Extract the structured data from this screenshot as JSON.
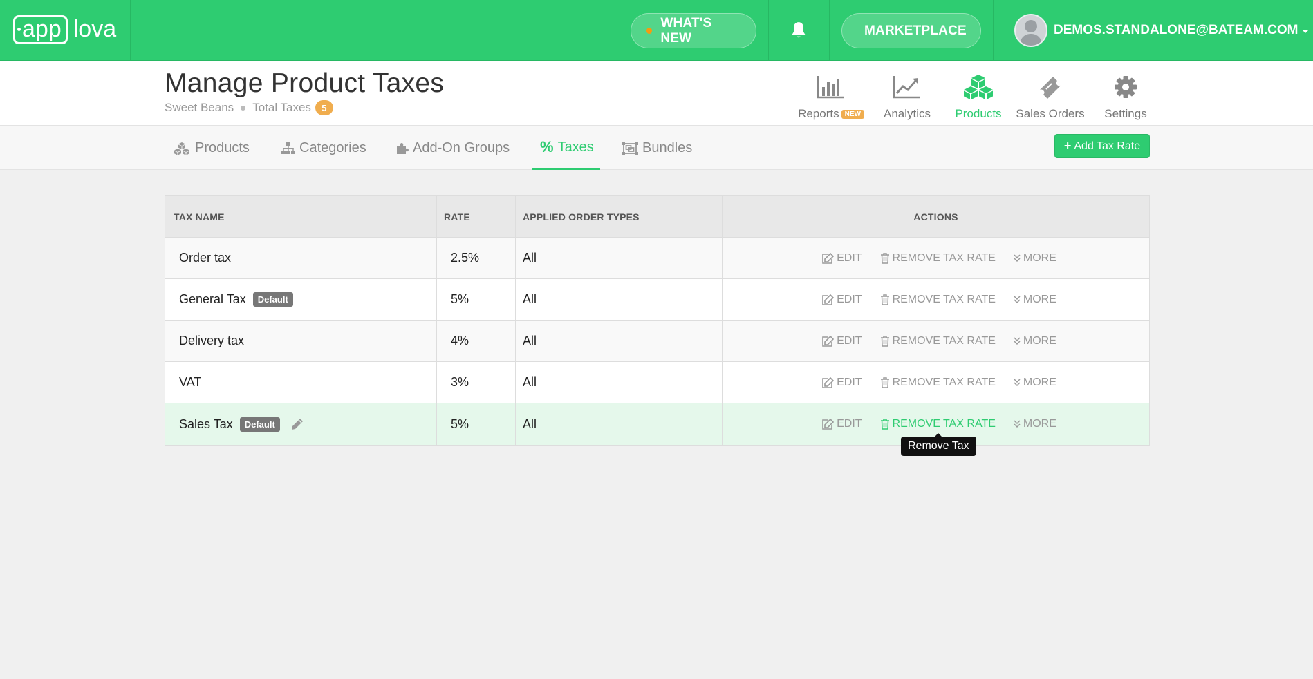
{
  "topbar": {
    "logo_left": "app",
    "logo_right": "lova",
    "whats_new_label": "WHAT'S NEW",
    "marketplace_label": "MARKETPLACE",
    "user_email": "DEMOS.STANDALONE@BATEAM.COM",
    "brand_color": "#2ecc71"
  },
  "header": {
    "title": "Manage Product Taxes",
    "store_name": "Sweet Beans",
    "total_label": "Total Taxes",
    "total_count": "5"
  },
  "nav": {
    "reports": "Reports",
    "reports_badge": "NEW",
    "analytics": "Analytics",
    "products": "Products",
    "sales_orders": "Sales Orders",
    "settings": "Settings"
  },
  "tabs": {
    "products": "Products",
    "categories": "Categories",
    "addon_groups": "Add-On Groups",
    "taxes": "Taxes",
    "bundles": "Bundles",
    "add_button": "Add Tax Rate"
  },
  "table": {
    "headers": {
      "name": "TAX NAME",
      "rate": "RATE",
      "order_types": "APPLIED ORDER TYPES",
      "actions": "ACTIONS"
    },
    "edit_label": "EDIT",
    "remove_label": "REMOVE TAX RATE",
    "more_label": "MORE",
    "default_label": "Default",
    "rows": [
      {
        "name": "Order tax",
        "rate": "2.5%",
        "types": "All"
      },
      {
        "name": "General Tax",
        "rate": "5%",
        "types": "All"
      },
      {
        "name": "Delivery tax",
        "rate": "4%",
        "types": "All"
      },
      {
        "name": "VAT",
        "rate": "3%",
        "types": "All"
      },
      {
        "name": "Sales Tax",
        "rate": "5%",
        "types": "All"
      }
    ]
  },
  "tooltip": {
    "text": "Remove Tax"
  }
}
